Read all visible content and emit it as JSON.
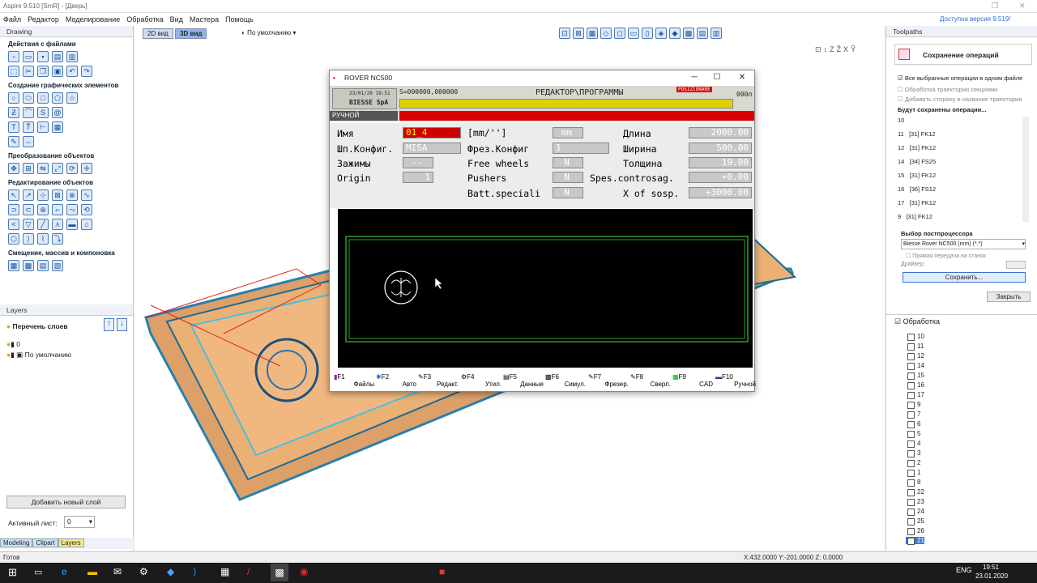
{
  "app": {
    "title": "Aspire 9.510 [SmR] - [Дверь]",
    "update": "Доступна версия 9.519!"
  },
  "menu": [
    "Файл",
    "Редактор",
    "Моделирование",
    "Обработка",
    "Вид",
    "Мастера",
    "Помощь"
  ],
  "left": {
    "panel_title": "Drawing",
    "sections": [
      "Действия с файлами",
      "Создание графических элементов",
      "Преобразование объектов",
      "Редактирование объектов",
      "Смещение, массив и компоновка"
    ],
    "layers_title": "Layers",
    "layers_list_title": "Перечень слоев",
    "layers": [
      "0",
      "По умолчанию"
    ],
    "add_layer": "Добавить новый слой",
    "active_sheet_label": "Активный лист:",
    "active_sheet_value": "0",
    "tabs": [
      "Modeling",
      "Clipart",
      "Layers"
    ]
  },
  "viewport": {
    "tabs": [
      "2D вид",
      "3D вид"
    ],
    "default_view": "По умолчанию"
  },
  "right": {
    "panel_title": "Toolpaths",
    "save_title": "Сохранение операций",
    "chk_all": "Все выбранные операции в одном файле",
    "chk_section": "Обработка траектории секциями",
    "chk_side": "Добавить сторону в название траектории",
    "will_save": "Будут сохранены операции...",
    "ops": [
      {
        "num": "10",
        "name": ""
      },
      {
        "num": "11",
        "name": "[31] FK12"
      },
      {
        "num": "12",
        "name": "[31] FK12"
      },
      {
        "num": "14",
        "name": "[34] FS25"
      },
      {
        "num": "15",
        "name": "[31] FK12"
      },
      {
        "num": "16",
        "name": "[36] FS12"
      },
      {
        "num": "17",
        "name": "[31] FK12"
      },
      {
        "num": "9",
        "name": "[31] FK12"
      }
    ],
    "pp_title": "Выбор постпроцессора",
    "pp_value": "Biesse Rover NC500 (mm) (*.*)",
    "direct": "Прямая передача на станок",
    "driver": "Драйвер:",
    "save_btn": "Сохранить...",
    "close_btn": "Закрыть",
    "processing_title": "Обработка",
    "tree": [
      "10",
      "11",
      "12",
      "14",
      "15",
      "16",
      "17",
      "9",
      "7",
      "6",
      "5",
      "4",
      "3",
      "2",
      "1",
      "8",
      "22",
      "23",
      "24",
      "25",
      "26",
      "21"
    ]
  },
  "status": {
    "ready": "Готов",
    "coords": "X:432.0000 Y:-201.0000 Z: 0.0000"
  },
  "taskbar": {
    "lang": "ENG",
    "time": "19:51",
    "date": "23.01.2020"
  },
  "rover": {
    "title": "ROVER NC500",
    "date": "23/01/20 19:51",
    "company": "BIESSE SpA",
    "s_value": "S=000000,000000",
    "header": "РЕДАКТОР\\ПРОГРАММЫ",
    "pos_label": "POSIZIONARE",
    "extra": "000л",
    "mode": "РУЧНОЙ",
    "fields": {
      "name_label": "Имя",
      "name_val": "01_4",
      "units_label": "[mm/'']",
      "units_val": "mm",
      "length_label": "Длина",
      "length_val": "2000.00",
      "sp_label": "Шп.Конфиг.",
      "sp_val": "MISA",
      "frez_label": "Фрез.Конфиг",
      "frez_val": "1",
      "width_label": "Ширина",
      "width_val": "500.00",
      "clamp_label": "Зажимы",
      "clamp_val": "--",
      "fw_label": "Free wheels",
      "fw_val": "N",
      "thick_label": "Толщина",
      "thick_val": "19.00",
      "origin_label": "Origin",
      "origin_val": "1",
      "push_label": "Pushers",
      "push_val": "N",
      "spes_label": "Spes.controsag.",
      "spes_val": "+0.00",
      "batt_label": "Batt.speciali",
      "batt_val": "N",
      "xsosp_label": "X of sosp.",
      "xsosp_val": "+3000.00"
    },
    "fkeys": [
      {
        "k": "F1",
        "l": "Файлы"
      },
      {
        "k": "F2",
        "l": "Авто"
      },
      {
        "k": "F3",
        "l": "Редакт."
      },
      {
        "k": "F4",
        "l": "Утил."
      },
      {
        "k": "F5",
        "l": "Данные"
      },
      {
        "k": "F6",
        "l": "Симул."
      },
      {
        "k": "F7",
        "l": "Фрезер."
      },
      {
        "k": "F8",
        "l": "Сверл."
      },
      {
        "k": "F9",
        "l": "CAD"
      },
      {
        "k": "F10",
        "l": "Ручной"
      }
    ]
  }
}
